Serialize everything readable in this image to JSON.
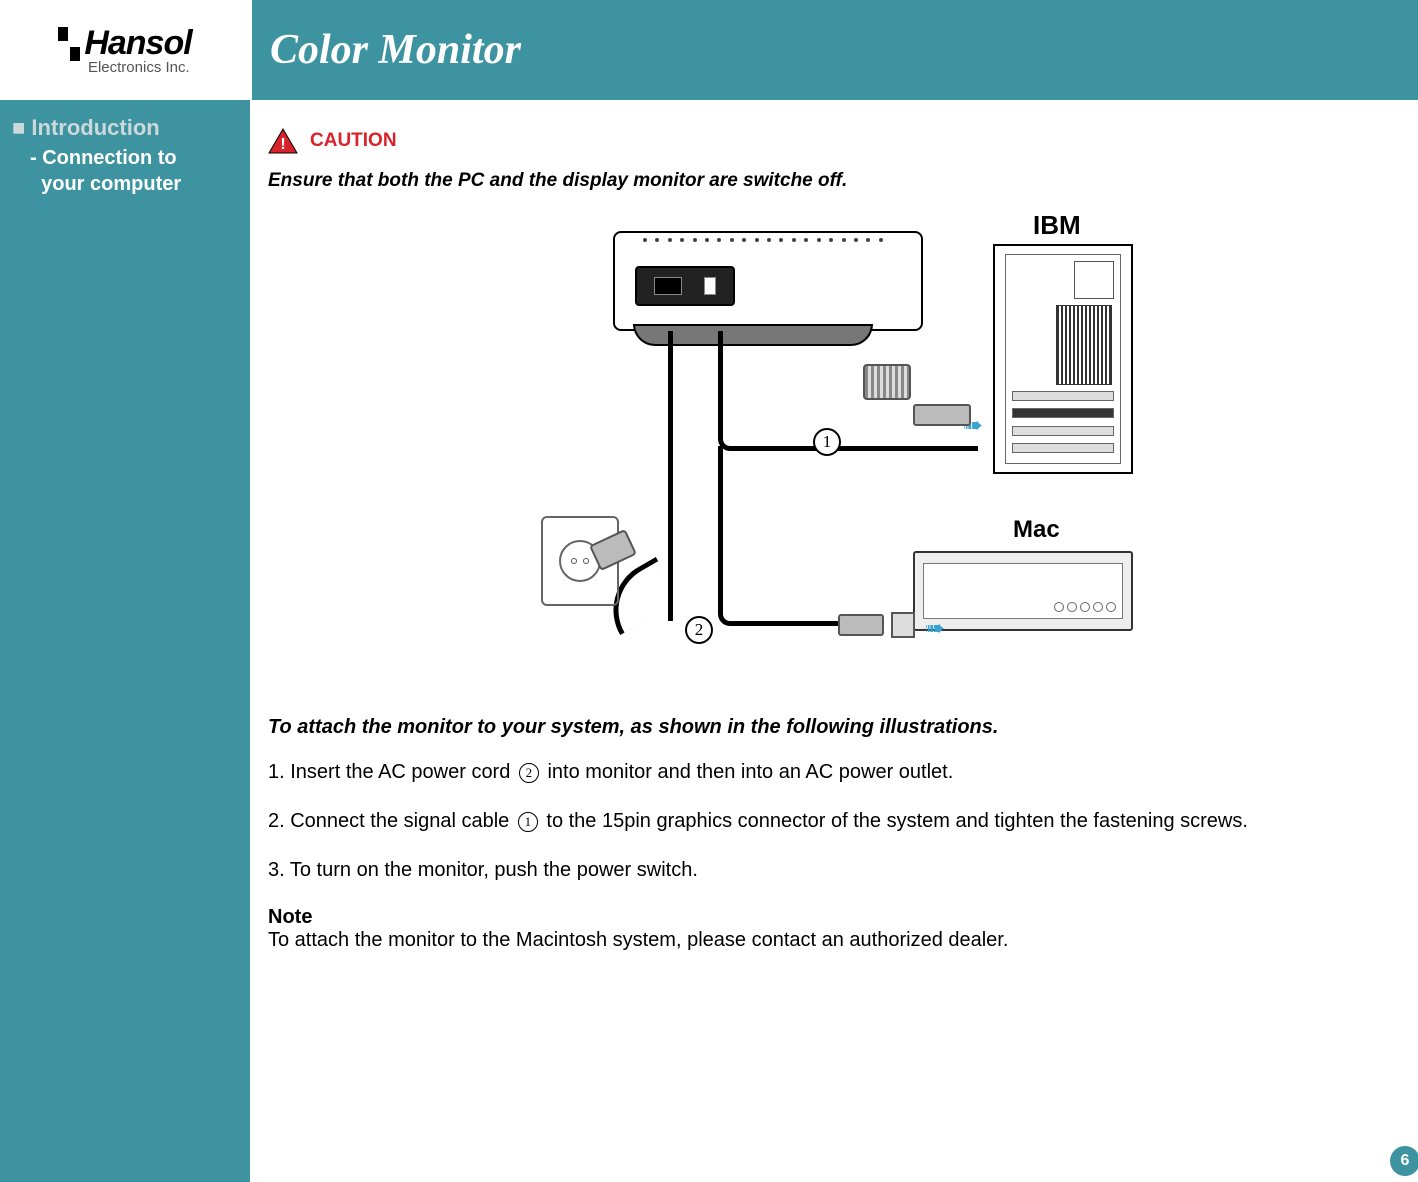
{
  "logo": {
    "name": "Hansol",
    "sub": "Electronics Inc."
  },
  "header": {
    "title": "Color Monitor"
  },
  "nav": {
    "section": "Introduction",
    "item": "- Connection to\n  your computer"
  },
  "caution": {
    "label": "CAUTION",
    "text": "Ensure that both the PC and the display monitor are switche off."
  },
  "diagram": {
    "ibm_label": "IBM",
    "mac_label": "Mac",
    "marker1": "1",
    "marker2": "2"
  },
  "instructions": {
    "heading": "To attach the monitor to your system, as shown in the following illustrations.",
    "steps": [
      {
        "prefix": "1. Insert the AC power cord ",
        "marker": "2",
        "suffix": " into monitor and then into an AC power outlet."
      },
      {
        "prefix": "2. Connect the signal cable ",
        "marker": "1",
        "suffix": " to the 15pin graphics connector of the system and tighten the fastening screws."
      },
      {
        "prefix": "3. To turn on the monitor, push the power switch.",
        "marker": "",
        "suffix": ""
      }
    ],
    "note_label": "Note",
    "note_text": "To attach the monitor to the Macintosh system, please contact an authorized dealer."
  },
  "page_number": "6"
}
